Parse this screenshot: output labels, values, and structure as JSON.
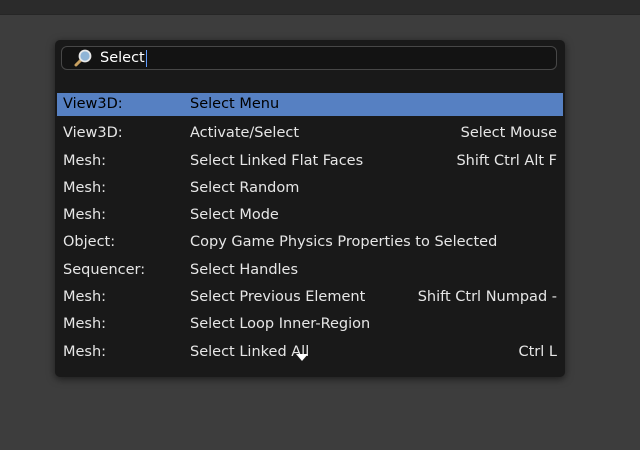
{
  "search": {
    "query": "Select",
    "icon": "magnifier-icon"
  },
  "results": [
    {
      "category": "View3D:",
      "name": "Select Menu",
      "hotkey": "",
      "selected": true
    },
    {
      "category": "View3D:",
      "name": "Activate/Select",
      "hotkey": "Select Mouse"
    },
    {
      "category": "Mesh:",
      "name": "Select Linked Flat Faces",
      "hotkey": "Shift Ctrl Alt F"
    },
    {
      "category": "Mesh:",
      "name": "Select Random",
      "hotkey": ""
    },
    {
      "category": "Mesh:",
      "name": "Select Mode",
      "hotkey": ""
    },
    {
      "category": "Object:",
      "name": "Copy Game Physics Properties to Selected",
      "hotkey": ""
    },
    {
      "category": "Sequencer:",
      "name": "Select Handles",
      "hotkey": ""
    },
    {
      "category": "Mesh:",
      "name": "Select Previous Element",
      "hotkey": "Shift Ctrl Numpad -"
    },
    {
      "category": "Mesh:",
      "name": "Select Loop Inner-Region",
      "hotkey": ""
    },
    {
      "category": "Mesh:",
      "name": "Select Linked All",
      "hotkey": "Ctrl L"
    }
  ],
  "colors": {
    "background": "#3d3d3d",
    "popup": "#191919",
    "highlight": "#5680c2",
    "text": "#e6e6e6"
  }
}
